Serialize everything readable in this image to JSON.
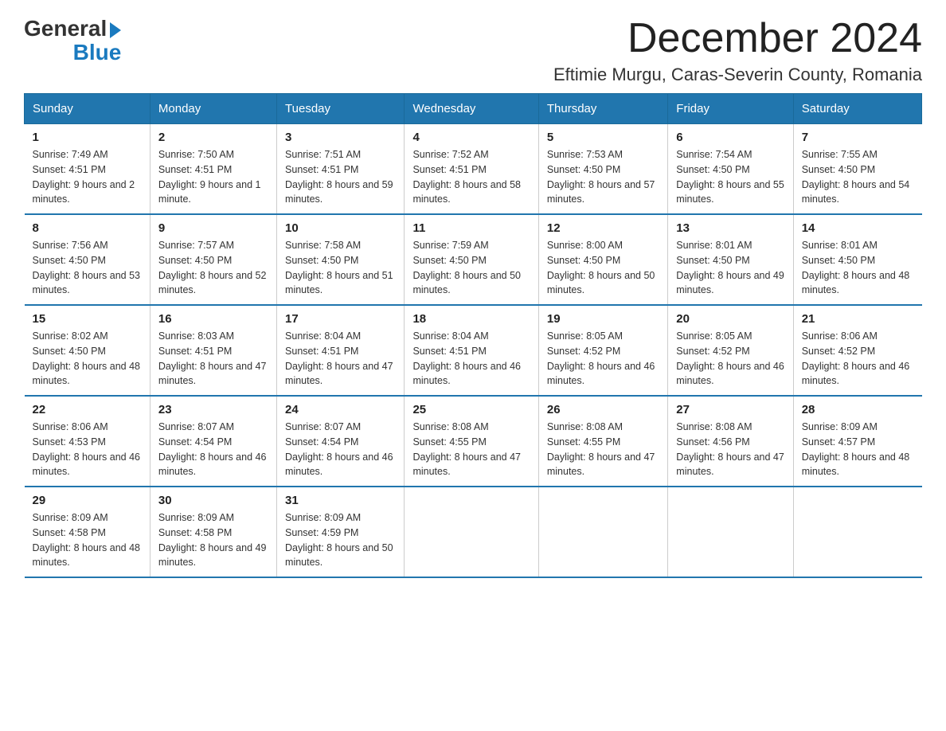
{
  "logo": {
    "general": "General",
    "blue": "Blue"
  },
  "title": "December 2024",
  "subtitle": "Eftimie Murgu, Caras-Severin County, Romania",
  "days_of_week": [
    "Sunday",
    "Monday",
    "Tuesday",
    "Wednesday",
    "Thursday",
    "Friday",
    "Saturday"
  ],
  "weeks": [
    [
      {
        "day": "1",
        "sunrise": "7:49 AM",
        "sunset": "4:51 PM",
        "daylight": "9 hours and 2 minutes."
      },
      {
        "day": "2",
        "sunrise": "7:50 AM",
        "sunset": "4:51 PM",
        "daylight": "9 hours and 1 minute."
      },
      {
        "day": "3",
        "sunrise": "7:51 AM",
        "sunset": "4:51 PM",
        "daylight": "8 hours and 59 minutes."
      },
      {
        "day": "4",
        "sunrise": "7:52 AM",
        "sunset": "4:51 PM",
        "daylight": "8 hours and 58 minutes."
      },
      {
        "day": "5",
        "sunrise": "7:53 AM",
        "sunset": "4:50 PM",
        "daylight": "8 hours and 57 minutes."
      },
      {
        "day": "6",
        "sunrise": "7:54 AM",
        "sunset": "4:50 PM",
        "daylight": "8 hours and 55 minutes."
      },
      {
        "day": "7",
        "sunrise": "7:55 AM",
        "sunset": "4:50 PM",
        "daylight": "8 hours and 54 minutes."
      }
    ],
    [
      {
        "day": "8",
        "sunrise": "7:56 AM",
        "sunset": "4:50 PM",
        "daylight": "8 hours and 53 minutes."
      },
      {
        "day": "9",
        "sunrise": "7:57 AM",
        "sunset": "4:50 PM",
        "daylight": "8 hours and 52 minutes."
      },
      {
        "day": "10",
        "sunrise": "7:58 AM",
        "sunset": "4:50 PM",
        "daylight": "8 hours and 51 minutes."
      },
      {
        "day": "11",
        "sunrise": "7:59 AM",
        "sunset": "4:50 PM",
        "daylight": "8 hours and 50 minutes."
      },
      {
        "day": "12",
        "sunrise": "8:00 AM",
        "sunset": "4:50 PM",
        "daylight": "8 hours and 50 minutes."
      },
      {
        "day": "13",
        "sunrise": "8:01 AM",
        "sunset": "4:50 PM",
        "daylight": "8 hours and 49 minutes."
      },
      {
        "day": "14",
        "sunrise": "8:01 AM",
        "sunset": "4:50 PM",
        "daylight": "8 hours and 48 minutes."
      }
    ],
    [
      {
        "day": "15",
        "sunrise": "8:02 AM",
        "sunset": "4:50 PM",
        "daylight": "8 hours and 48 minutes."
      },
      {
        "day": "16",
        "sunrise": "8:03 AM",
        "sunset": "4:51 PM",
        "daylight": "8 hours and 47 minutes."
      },
      {
        "day": "17",
        "sunrise": "8:04 AM",
        "sunset": "4:51 PM",
        "daylight": "8 hours and 47 minutes."
      },
      {
        "day": "18",
        "sunrise": "8:04 AM",
        "sunset": "4:51 PM",
        "daylight": "8 hours and 46 minutes."
      },
      {
        "day": "19",
        "sunrise": "8:05 AM",
        "sunset": "4:52 PM",
        "daylight": "8 hours and 46 minutes."
      },
      {
        "day": "20",
        "sunrise": "8:05 AM",
        "sunset": "4:52 PM",
        "daylight": "8 hours and 46 minutes."
      },
      {
        "day": "21",
        "sunrise": "8:06 AM",
        "sunset": "4:52 PM",
        "daylight": "8 hours and 46 minutes."
      }
    ],
    [
      {
        "day": "22",
        "sunrise": "8:06 AM",
        "sunset": "4:53 PM",
        "daylight": "8 hours and 46 minutes."
      },
      {
        "day": "23",
        "sunrise": "8:07 AM",
        "sunset": "4:54 PM",
        "daylight": "8 hours and 46 minutes."
      },
      {
        "day": "24",
        "sunrise": "8:07 AM",
        "sunset": "4:54 PM",
        "daylight": "8 hours and 46 minutes."
      },
      {
        "day": "25",
        "sunrise": "8:08 AM",
        "sunset": "4:55 PM",
        "daylight": "8 hours and 47 minutes."
      },
      {
        "day": "26",
        "sunrise": "8:08 AM",
        "sunset": "4:55 PM",
        "daylight": "8 hours and 47 minutes."
      },
      {
        "day": "27",
        "sunrise": "8:08 AM",
        "sunset": "4:56 PM",
        "daylight": "8 hours and 47 minutes."
      },
      {
        "day": "28",
        "sunrise": "8:09 AM",
        "sunset": "4:57 PM",
        "daylight": "8 hours and 48 minutes."
      }
    ],
    [
      {
        "day": "29",
        "sunrise": "8:09 AM",
        "sunset": "4:58 PM",
        "daylight": "8 hours and 48 minutes."
      },
      {
        "day": "30",
        "sunrise": "8:09 AM",
        "sunset": "4:58 PM",
        "daylight": "8 hours and 49 minutes."
      },
      {
        "day": "31",
        "sunrise": "8:09 AM",
        "sunset": "4:59 PM",
        "daylight": "8 hours and 50 minutes."
      },
      null,
      null,
      null,
      null
    ]
  ]
}
